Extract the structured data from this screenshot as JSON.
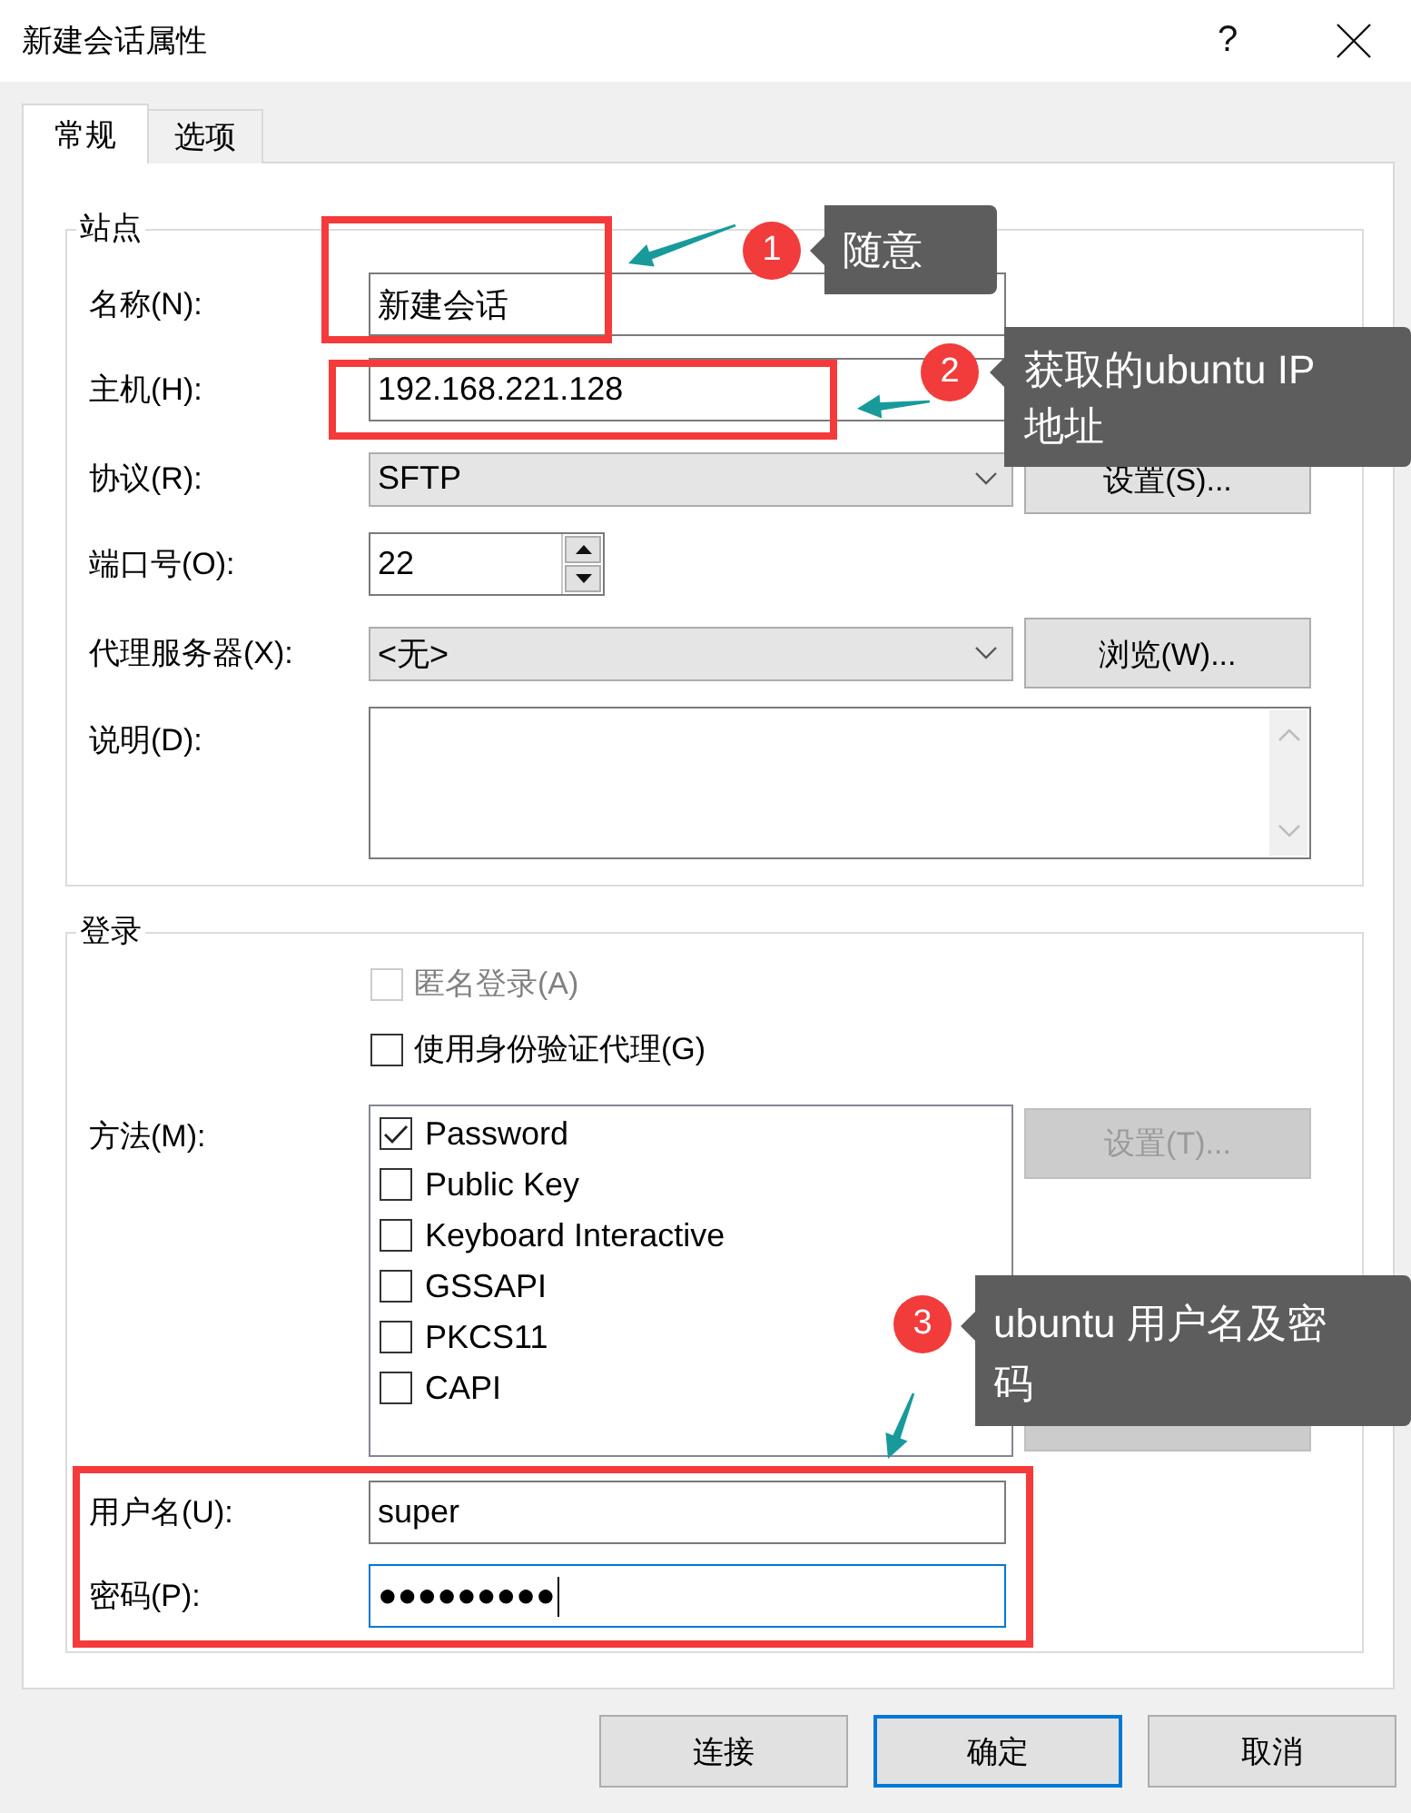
{
  "window": {
    "title": "新建会话属性",
    "help": "?"
  },
  "tabs": [
    {
      "label": "常规",
      "selected": true
    },
    {
      "label": "选项",
      "selected": false
    }
  ],
  "site": {
    "title": "站点",
    "fields": [
      {
        "kind": "text",
        "label": "名称(N):",
        "value": "新建会话"
      },
      {
        "kind": "text",
        "label": "主机(H):",
        "value": "192.168.221.128"
      },
      {
        "kind": "dropdown",
        "label": "协议(R):",
        "value": "SFTP",
        "button": "设置(S)..."
      },
      {
        "kind": "spin",
        "label": "端口号(O):",
        "value": "22"
      },
      {
        "kind": "dropdown",
        "label": "代理服务器(X):",
        "value": "<无>",
        "button": "浏览(W)..."
      },
      {
        "kind": "textarea",
        "label": "说明(D):"
      }
    ]
  },
  "login": {
    "title": "登录",
    "options": [
      {
        "label": "匿名登录(A)",
        "checked": false,
        "disabled": true
      },
      {
        "label": "使用身份验证代理(G)",
        "checked": false,
        "disabled": false
      }
    ],
    "method_label": "方法(M):",
    "methods": [
      {
        "label": "Password",
        "checked": true
      },
      {
        "label": "Public Key",
        "checked": false
      },
      {
        "label": "Keyboard Interactive",
        "checked": false
      },
      {
        "label": "GSSAPI",
        "checked": false
      },
      {
        "label": "PKCS11",
        "checked": false
      },
      {
        "label": "CAPI",
        "checked": false
      }
    ],
    "method_buttons": [
      {
        "label": "设置(T)...",
        "disabled": true
      },
      {
        "disabled": true
      }
    ],
    "credentials": [
      {
        "label": "用户名(U):",
        "value": "super",
        "focused": false
      },
      {
        "label": "密码(P):",
        "value": "●●●●●●●●●",
        "focused": true
      }
    ]
  },
  "footer_buttons": [
    {
      "label": "连接",
      "default": false
    },
    {
      "label": "确定",
      "default": true
    },
    {
      "label": "取消",
      "default": false
    }
  ],
  "annotations": [
    {
      "number": "1",
      "text": "随意"
    },
    {
      "number": "2",
      "text": "获取的ubuntu IP 地址"
    },
    {
      "number": "3",
      "text": "ubuntu 用户名及密码"
    }
  ]
}
